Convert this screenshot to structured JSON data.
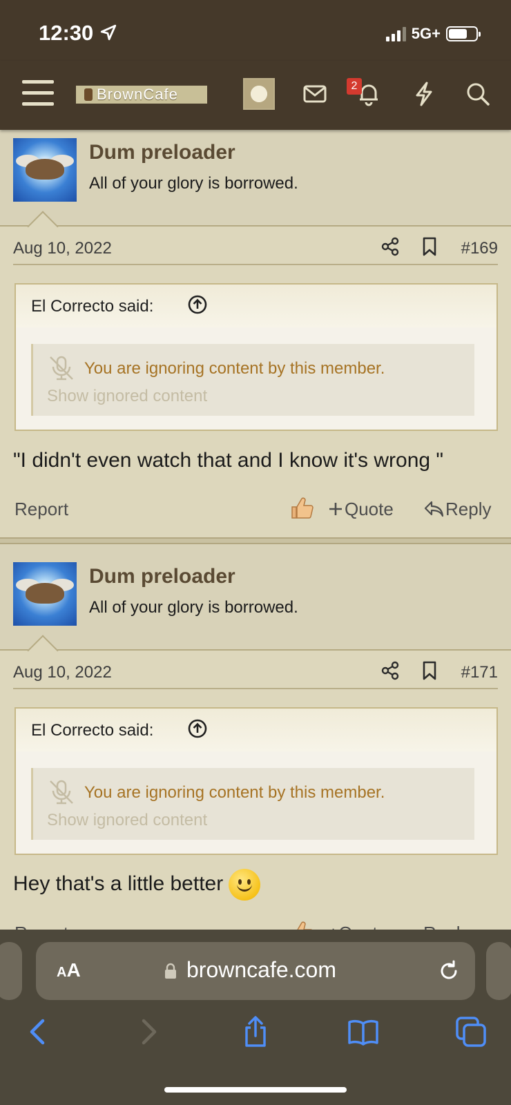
{
  "status_bar": {
    "time": "12:30",
    "network": "5G+"
  },
  "nav": {
    "site_name": "BrownCafe",
    "notification_count": "2"
  },
  "posts": [
    {
      "username": "Dum preloader",
      "user_title": "All of your glory is borrowed.",
      "date": "Aug 10, 2022",
      "number": "#169",
      "quote_author": "El Correcto said:",
      "ignored_text": "You are ignoring content by this member.",
      "show_ignored": "Show ignored content",
      "message": "\"I didn't even watch that and I know it's wrong \"",
      "report": "Report",
      "quote": "Quote",
      "reply": "Reply"
    },
    {
      "username": "Dum preloader",
      "user_title": "All of your glory is borrowed.",
      "date": "Aug 10, 2022",
      "number": "#171",
      "quote_author": "El Correcto said:",
      "ignored_text": "You are ignoring content by this member.",
      "show_ignored": "Show ignored content",
      "message": "Hey that's a little better",
      "report": "Report",
      "quote": "Quote",
      "reply": "Reply"
    }
  ],
  "browser": {
    "aa_label_small": "A",
    "aa_label_large": "A",
    "url": "browncafe.com"
  },
  "colors": {
    "header_bg": "#45392a",
    "page_bg": "#d8d2b8",
    "ignored_text": "#a67324",
    "badge": "#d43a2f",
    "toolbar_blue": "#4f8ef7"
  },
  "icons": [
    "menu-icon",
    "envelope-icon",
    "bell-icon",
    "bolt-icon",
    "search-icon",
    "share-icon",
    "bookmark-icon",
    "arrow-up-circle-icon",
    "mute-icon",
    "like-icon",
    "plus-icon",
    "reply-icon",
    "lock-icon",
    "reload-icon",
    "back-icon",
    "forward-icon",
    "share-sheet-icon",
    "bookmarks-icon",
    "tabs-icon"
  ]
}
